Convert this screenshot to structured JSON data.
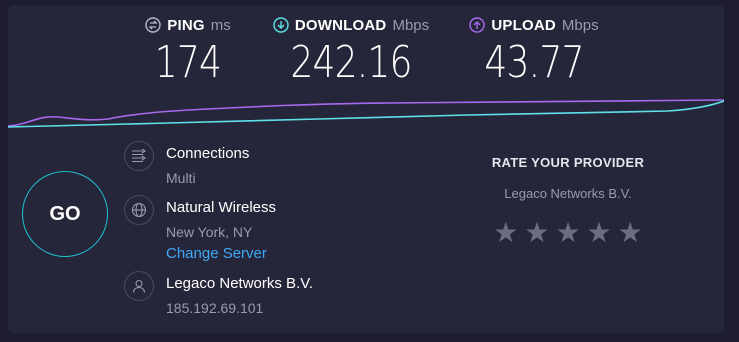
{
  "metrics": {
    "ping": {
      "label": "PING",
      "unit": "ms",
      "value": "174"
    },
    "download": {
      "label": "DOWNLOAD",
      "unit": "Mbps",
      "value": "242.16"
    },
    "upload": {
      "label": "UPLOAD",
      "unit": "Mbps",
      "value": "43.77"
    }
  },
  "colors": {
    "download": "#5ee1e8",
    "upload": "#a869f0",
    "go_ring": "#1ec3d0",
    "link": "#3fa8f4"
  },
  "go_label": "GO",
  "connections": {
    "title": "Connections",
    "value": "Multi"
  },
  "server": {
    "name": "Natural Wireless",
    "location": "New York, NY",
    "change_label": "Change Server"
  },
  "isp": {
    "name": "Legaco Networks B.V.",
    "ip": "185.192.69.101"
  },
  "rating": {
    "title": "RATE YOUR PROVIDER",
    "provider": "Legaco Networks B.V.",
    "stars_total": 5,
    "stars_selected": 0
  },
  "icons": {
    "ping": "ping-icon",
    "download": "download-arrow-icon",
    "upload": "upload-arrow-icon",
    "connections": "connections-icon",
    "server": "globe-icon",
    "isp": "user-icon",
    "star": "star-icon"
  }
}
